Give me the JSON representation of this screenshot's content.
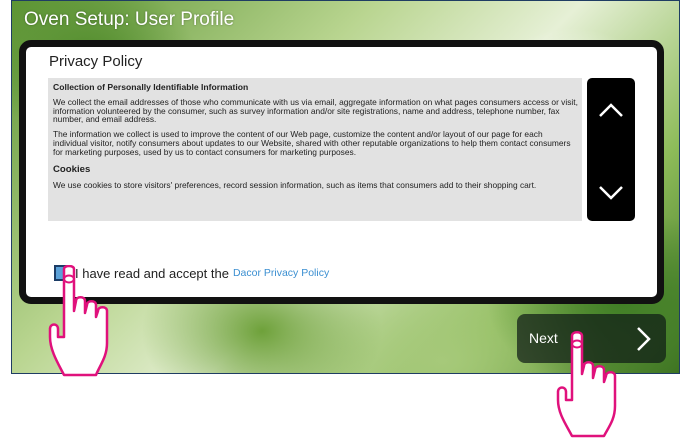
{
  "screen": {
    "title": "Oven Setup: User Profile"
  },
  "dialog": {
    "title": "Privacy Policy",
    "sections": {
      "heading1": "Collection of Personally Identifiable Information",
      "para1": "We collect the email addresses of those who communicate with us via email, aggregate information on what pages consumers access or visit, information volunteered by the consumer, such as survey information and/or site registrations, name and address, telephone number, fax number, and email address.",
      "para2": "The information we collect is used to improve the content of our Web page, customize the content and/or layout of our page for each individual visitor, notify consumers about updates to our Website, shared with other reputable organizations to help them contact consumers for marketing purposes, used by us to contact consumers for marketing purposes.",
      "heading2": "Cookies",
      "para3": "We use cookies to store visitors' preferences, record session information, such as items that consumers add to their shopping cart."
    },
    "scroll_up_icon": "chevron-up-icon",
    "scroll_down_icon": "chevron-down-icon",
    "accept_text": "I have read and accept the",
    "accept_link": "Dacor Privacy Policy",
    "accept_checked": true
  },
  "next_button": {
    "label": "Next",
    "icon": "chevron-right-icon"
  },
  "colors": {
    "checkbox": "#5ba1d8",
    "link": "#3b8fd1",
    "hand": "#e0117c",
    "dialog_border": "#111111"
  }
}
